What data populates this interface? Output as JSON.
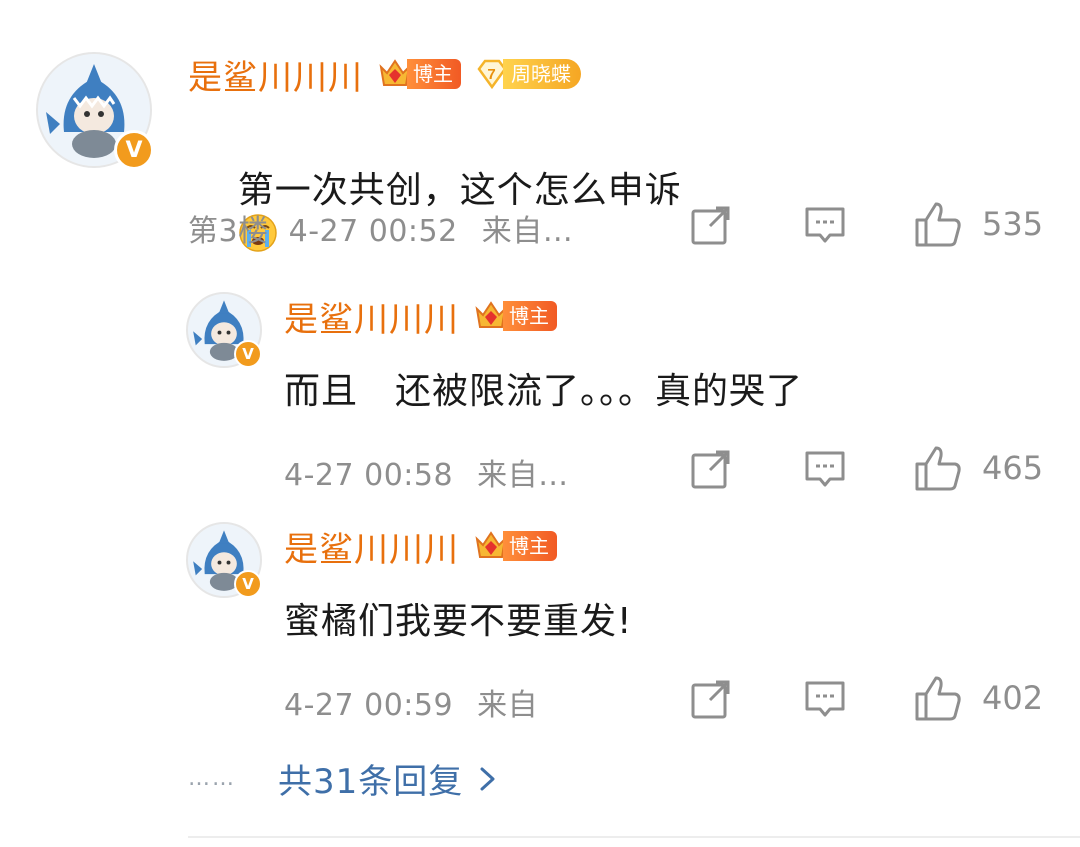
{
  "main_comment": {
    "username": "是鲨川川川",
    "badge_blogger": "博主",
    "badge_fan_level": "7",
    "badge_fan_text": "周晓蝶",
    "content": "第一次共创，这个怎么申诉",
    "emoji": "crying-face",
    "floor": "第3楼",
    "time": "4-27 00:52",
    "source": "来自…",
    "likes": "535"
  },
  "replies": [
    {
      "username": "是鲨川川川",
      "badge_blogger": "博主",
      "content": "而且　还被限流了。。。真的哭了",
      "time": "4-27 00:58",
      "source": "来自…",
      "likes": "465"
    },
    {
      "username": "是鲨川川川",
      "badge_blogger": "博主",
      "content": "蜜橘们我要不要重发!",
      "time": "4-27 00:59",
      "source": "来自",
      "likes": "402"
    }
  ],
  "more_replies": {
    "dots": "……",
    "label": "共31条回复"
  },
  "colors": {
    "username": "#e8700d",
    "link": "#3f6fa8",
    "meta": "#8e8e8e"
  }
}
